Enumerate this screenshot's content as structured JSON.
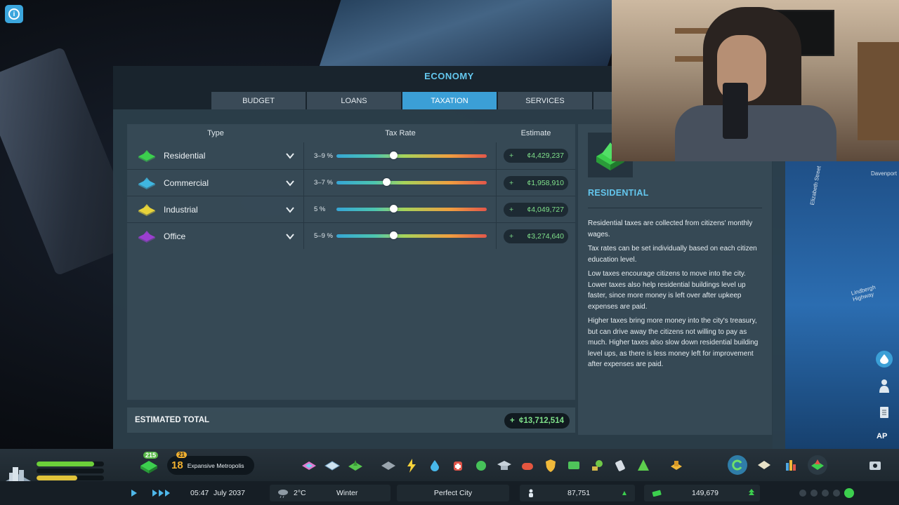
{
  "window": {
    "title": "ECONOMY",
    "tabs": [
      "BUDGET",
      "LOANS",
      "TAXATION",
      "SERVICES"
    ],
    "active_tab": "TAXATION"
  },
  "table": {
    "headers": {
      "type": "Type",
      "rate": "Tax Rate",
      "estimate": "Estimate"
    },
    "rows": [
      {
        "name": "Residential",
        "rate_label": "3–9 %",
        "slider_fraction": 0.38,
        "plus": "+",
        "estimate": "¢4,429,237",
        "color": "#3ccf4e"
      },
      {
        "name": "Commercial",
        "rate_label": "3–7 %",
        "slider_fraction": 0.33,
        "plus": "+",
        "estimate": "¢1,958,910",
        "color": "#3fb6e0"
      },
      {
        "name": "Industrial",
        "rate_label": "5 %",
        "slider_fraction": 0.38,
        "plus": "+",
        "estimate": "¢4,049,727",
        "color": "#e8d33a"
      },
      {
        "name": "Office",
        "rate_label": "5–9 %",
        "slider_fraction": 0.38,
        "plus": "+",
        "estimate": "¢3,274,640",
        "color": "#9b3fd0"
      }
    ]
  },
  "total": {
    "label": "ESTIMATED TOTAL",
    "plus": "+",
    "value": "¢13,712,514"
  },
  "info": {
    "heading": "RESIDENTIAL",
    "paragraphs": [
      "Residential taxes are collected from citizens' monthly wages.",
      "Tax rates can be set individually based on each citizen education level.",
      "Low taxes encourage citizens to move into the city. Lower taxes also help residential buildings level up faster, since more money is left over after upkeep expenses are paid.",
      "Higher taxes bring more money into the city's treasury, but can drive away the citizens not willing to pay as much. Higher taxes also slow down residential building level ups, as there is less money left for improvement after expenses are paid."
    ]
  },
  "map": {
    "street_labels": [
      "Elizabeth Street",
      "Lindbergh Highway",
      "Davenport"
    ]
  },
  "hud": {
    "level_badge": "215",
    "milestone_number": "18",
    "milestone_badge": "21",
    "milestone_name": "Expansive Metropolis",
    "time": "05:47",
    "date": "July 2037",
    "temperature": "2°C",
    "season": "Winter",
    "city_name": "Perfect City",
    "population": "87,751",
    "money": "149,679",
    "ap_label": "AP",
    "bar_fills": [
      0.85,
      0.0,
      0.6
    ],
    "bar_colors": [
      "#6ccf3a",
      "#0f161b",
      "#e0c23a"
    ]
  },
  "colors": {
    "accent": "#3b9fd6",
    "title": "#64c7ee",
    "positive": "#7fe08a"
  }
}
